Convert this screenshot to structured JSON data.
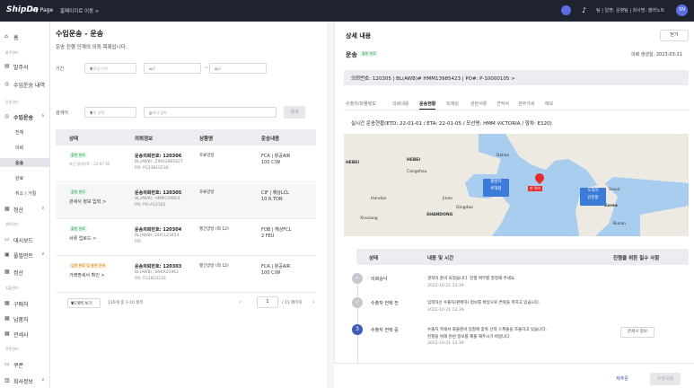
{
  "header": {
    "logo": "ShipDa",
    "mypage": "My Page",
    "home_link": "홈페이지로 이동 >",
    "user": "팀 | 일명: 운영팀 | 회사명: 셀러노트",
    "avatar": "SN"
  },
  "sidebar": {
    "home": "홈",
    "sec1": "발주관리",
    "order": "발주서",
    "import_inquiry": "수입운송 내역",
    "sec2": "운송관리",
    "import": "수입운송",
    "sub": [
      "전체",
      "의뢰",
      "운송",
      "완료",
      "취소 / 거절"
    ],
    "settle": "정산",
    "sec3": "센터관리",
    "dashboard": "대시보드",
    "fulfill": "풀필먼트",
    "settle2": "정산",
    "sec4": "입출관리",
    "order2": "구매처",
    "ship_to": "납품처",
    "customs": "관세사",
    "sec5": "쿠폰관리",
    "coupon": "쿠폰",
    "more": "회사정보"
  },
  "list": {
    "title": "수입운송 - 운송",
    "desc": "운송 진행 단계의 의뢰 목록입니다.",
    "period_label": "기간",
    "period_select": "기준일 선택",
    "date_start": "시작",
    "date_end": "종료",
    "date_sep": "~",
    "search_label": "검색어",
    "search_select": "항목 선택",
    "search_placeholder": "검색어 입력",
    "search_btn": "검색",
    "columns": [
      "상태",
      "의뢰정보",
      "상품명",
      "운송내용"
    ],
    "rows": [
      {
        "badge": "출항 완료",
        "status": "최근 업데이트 : 22-07-30",
        "no": "운송의뢰번호: 120306",
        "bl": "BL(AWB): ZIM33985427",
        "po": "PO: P123810230",
        "prod": "조류양방",
        "ship1": "FCA | 항공AIR",
        "ship2": "100 C/W"
      },
      {
        "badge": "출항 완료",
        "status": "관세사 정보 입력 >",
        "no": "운송의뢰번호: 120305",
        "bl": "BL(AWB): HMM139854",
        "po": "PO: PO-A12345",
        "prod": "조류양방",
        "ship1": "CIF | 해상LCL",
        "ship2": "10 R.TON"
      },
      {
        "badge": "출항 완료",
        "status": "서류 업로드 >",
        "no": "운송의뢰번호: 120304",
        "bl": "BL(AWB): DOCL23454",
        "po": "PO:",
        "prod": "펭긴양방 (외 12)",
        "ship1": "FOB | 해상FCL",
        "ship2": "2 FEU"
      },
      {
        "badge": "입항 완료 및 통관 준비",
        "status": "거래명세서 확인 >",
        "no": "운송의뢰번호: 120303",
        "bl": "BL(AWB): SNKR22962",
        "po": "PO: P12810233",
        "prod": "펭긴양방 (외 12)",
        "ship1": "FCA | 항공AIR",
        "ship2": "100 C/W"
      }
    ],
    "page_size": "15개씩 보기",
    "count_text": "110개 중 1-10 항목",
    "page": "1",
    "total_pages": "/ 11 페이지",
    "prev": "‹",
    "next": "›"
  },
  "detail": {
    "title": "상세 내용",
    "close": "닫기",
    "sub": "운송",
    "badge": "출항 완료",
    "date": "의뢰 생성일: 2023-03-21",
    "ids": "의뢰번호: 120305   |   BL(AWB)# HMM13985423   |   PO#: P-10000105 >",
    "tabs": [
      "수출자/화물정보",
      "의뢰내용",
      "운송현황",
      "트래킹",
      "관련서류",
      "견적서",
      "관부가세",
      "메모"
    ],
    "status": "실시간 운송현황(ETD: 22-01-01 / ETA: 22-01-05 / 모선명: HMM VICTORIA / 항차: E120)",
    "map": {
      "pin1_a": "출발지",
      "pin1_b": "위해항",
      "pin2_a": "도착지",
      "pin2_b": "인천항",
      "red": "현 위치",
      "labels": [
        "HEBEI",
        "Cangzhou",
        "Dalian",
        "SHANDONG",
        "Jinan",
        "Qingdao",
        "Handan",
        "Xinxiang",
        "Seoul",
        "Korea",
        "Busan"
      ]
    },
    "timeline_head": [
      "상태",
      "내용 및 시간",
      "진행을 위한 필수 사항"
    ],
    "timeline": [
      {
        "name": "의뢰승낙",
        "desc": "견적이 준비 되었습니다. 진행 여부를 결정해 주세요.",
        "time": "2022-10-21 13:39",
        "num": "✓"
      },
      {
        "name": "수출자 컨택 전",
        "desc": "입력하신 수출자(판매자) 정보를 바탕으로 연락을 취하고 있습니다.",
        "time": "2022-10-21 13:39",
        "num": "✓"
      },
      {
        "name": "수출자 컨택 중",
        "desc": "수출자 측에서 화물준비 일정에 맞춰 선적 스케줄을 조율하고 있습니다.",
        "desc2": "진행을 위해 관련 정보를 제출 해주시기 바랍니다.",
        "time": "2022-10-21 13:39",
        "num": "3",
        "btn": "관세사 정보"
      }
    ],
    "footer_btn1": "제주문",
    "footer_btn2": "수정요청"
  },
  "colors": {
    "dark": "#1f2330",
    "accent": "#3d5ab8",
    "green": "#1a9a4a"
  }
}
